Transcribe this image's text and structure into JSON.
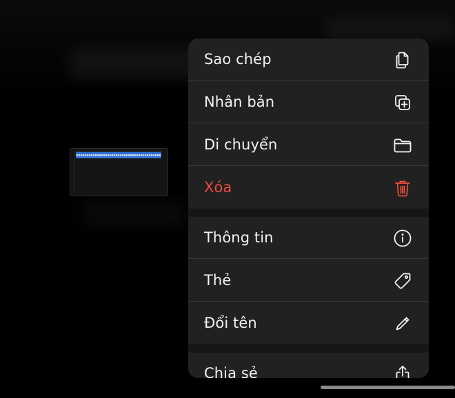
{
  "context_menu": {
    "groups": [
      [
        {
          "label": "Sao chép",
          "icon": "copy-icon"
        },
        {
          "label": "Nhân bản",
          "icon": "duplicate-icon"
        },
        {
          "label": "Di chuyển",
          "icon": "folder-icon"
        },
        {
          "label": "Xóa",
          "icon": "trash-icon",
          "color": "#eb4d3d"
        }
      ],
      [
        {
          "label": "Thông tin",
          "icon": "info-icon"
        },
        {
          "label": "Thẻ",
          "icon": "tag-icon"
        },
        {
          "label": "Đổi tên",
          "icon": "pencil-icon"
        }
      ],
      [
        {
          "label": "Chia sẻ",
          "icon": "share-icon"
        }
      ]
    ]
  },
  "colors": {
    "menu_background": "#212121",
    "text": "#f2f2f2",
    "destructive": "#eb4d3d",
    "thumbnail_track": "#2f6fd0"
  }
}
